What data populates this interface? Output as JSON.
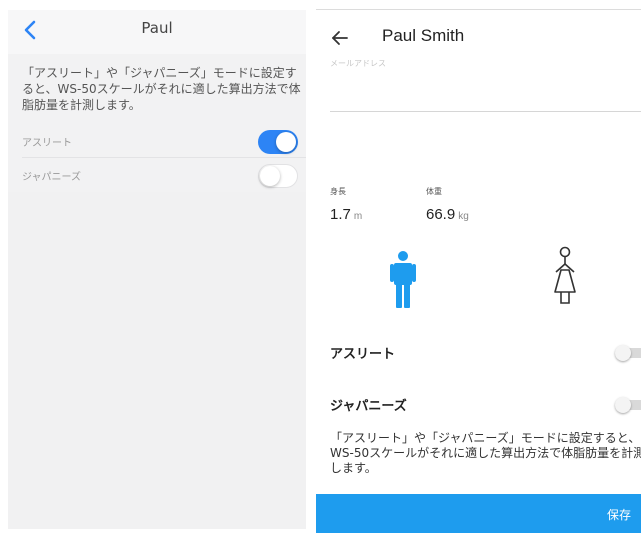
{
  "left": {
    "title": "Paul",
    "description": "「アスリート」や「ジャパニーズ」モードに設定すると、WS-50スケールがそれに適した算出方法で体脂肪量を計測します。",
    "toggles": [
      {
        "label": "アスリート",
        "on": true
      },
      {
        "label": "ジャパニーズ",
        "on": false
      }
    ]
  },
  "right": {
    "title": "Paul Smith",
    "email_label": "メールアドレス",
    "height_label": "身長",
    "height_value": "1.7",
    "height_unit": "m",
    "weight_label": "体重",
    "weight_value": "66.9",
    "weight_unit": "kg",
    "switches": [
      {
        "label": "アスリート",
        "on": false
      },
      {
        "label": "ジャパニーズ",
        "on": false
      }
    ],
    "description": "「アスリート」や「ジャパニーズ」モードに設定すると、WS-50スケールがそれに適した算出方法で体脂肪量を計測します。",
    "save_label": "保存",
    "gender_selected": "male"
  },
  "colors": {
    "ios_blue": "#2d84f5",
    "android_blue": "#1e9cee",
    "male_selected": "#1e9cee"
  },
  "icons": {
    "left_back": "chevron-left-icon",
    "right_back": "arrow-left-icon",
    "male": "male-person-icon",
    "female": "female-person-icon"
  }
}
